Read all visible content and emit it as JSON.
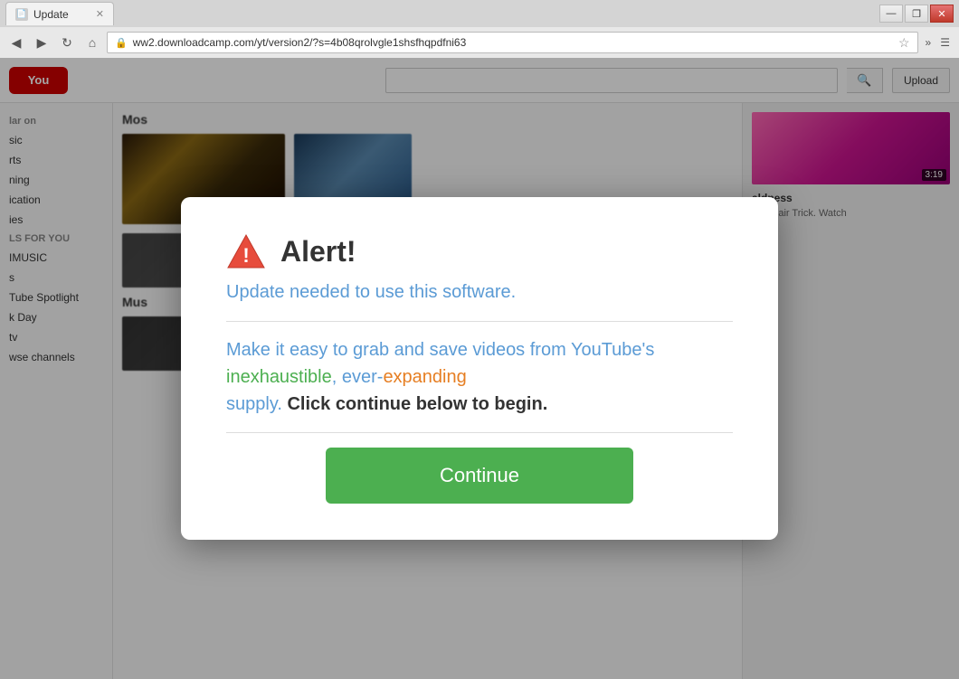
{
  "browser": {
    "tab_title": "Update",
    "address": "ww2.downloadcamp.com/yt/version2/?s=4b08qrolvgle1shsfhqpdfni63",
    "window_controls": {
      "minimize": "—",
      "maximize": "❐",
      "close": "✕"
    },
    "nav": {
      "back": "◀",
      "forward": "▶",
      "refresh": "↻",
      "home": "⌂"
    }
  },
  "youtube": {
    "logo": "You",
    "upload_btn": "Upload",
    "sidebar": {
      "section1": "lar on",
      "items": [
        "sic",
        "rts",
        "ning",
        "ication",
        "ies"
      ],
      "section2": "LS FOR YOU",
      "items2": [
        "IMUSIC",
        "s",
        "Tube Spotlight",
        "k Day",
        "tv"
      ],
      "browse": "wse channels"
    },
    "sections": {
      "most_popular": "Mos",
      "music": "Mus"
    },
    "right_thumb_badge": "3:19",
    "right_title": "aldness",
    "right_desc": "d of Hair\nTrick. Watch"
  },
  "dialog": {
    "title": "Alert!",
    "subtitle": "Update needed to use this software.",
    "body_part1": "Make it easy to grab and save videos from YouTube's inexhaustible, ever-expanding supply.",
    "body_bold": "Click continue below to begin.",
    "continue_label": "Continue"
  }
}
